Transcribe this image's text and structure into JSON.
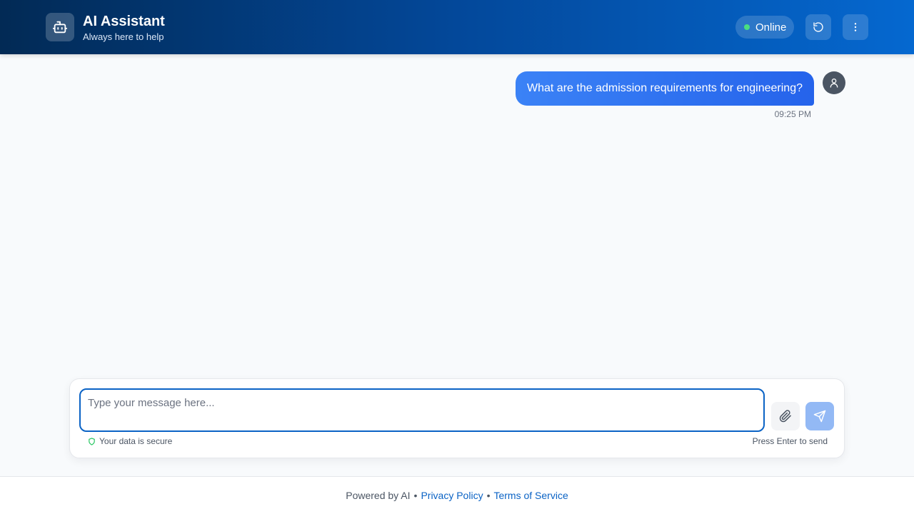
{
  "header": {
    "title": "AI Assistant",
    "subtitle": "Always here to help",
    "status": "Online",
    "icons": {
      "logo": "robot-icon",
      "refresh": "refresh-icon",
      "menu": "more-vertical-icon"
    }
  },
  "chat": {
    "messages": [
      {
        "sender": "user",
        "text": "What are the admission requirements for engineering?",
        "time": "09:25 PM"
      }
    ]
  },
  "composer": {
    "placeholder": "Type your message here...",
    "value": "",
    "security_note": "Your data is secure",
    "hint": "Press Enter to send"
  },
  "footer": {
    "powered_by": "Powered by AI",
    "separator": "•",
    "links": [
      "Privacy Policy",
      "Terms of Service"
    ]
  },
  "colors": {
    "header_start": "#022a55",
    "header_end": "#0568d0",
    "bubble": "#3b82f6",
    "accent": "#0b63c5",
    "status_dot": "#4ade80",
    "send_button": "#93b9f5"
  }
}
